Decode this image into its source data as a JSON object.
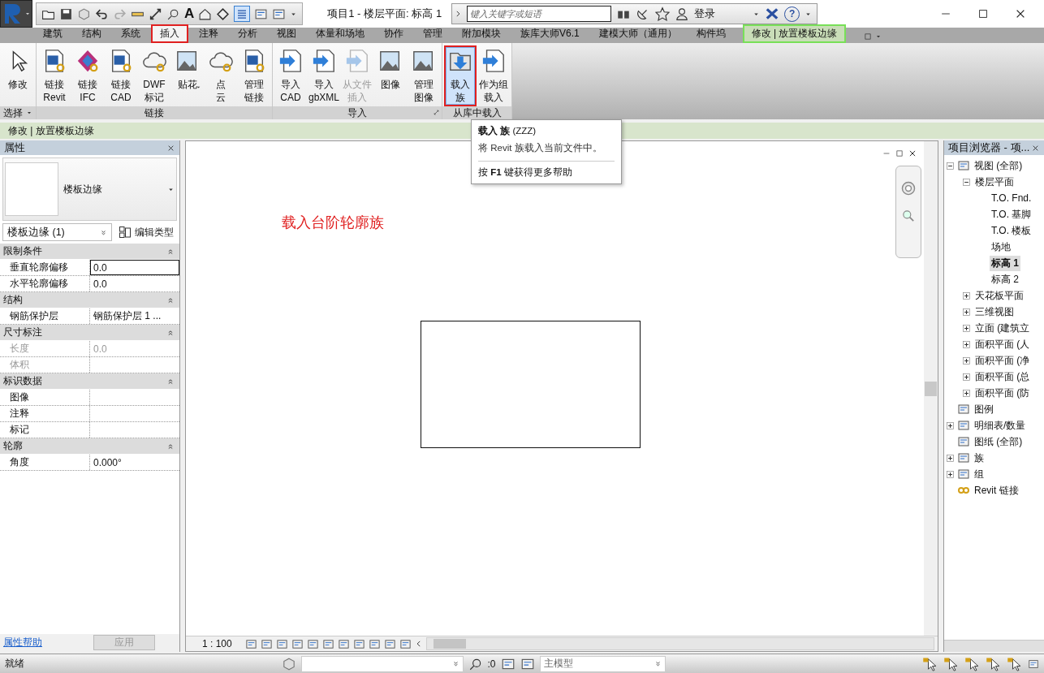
{
  "quick_access": {
    "text_tool": "A",
    "thin_lines_on": true
  },
  "title": "项目1 - 楼层平面: 标高 1",
  "search": {
    "placeholder": "键入关键字或短语"
  },
  "login": "登录",
  "help": "?",
  "tabs": [
    {
      "label": "建筑",
      "selected": false,
      "kind": "normal",
      "annotated": false
    },
    {
      "label": "结构",
      "selected": false,
      "kind": "normal",
      "annotated": false
    },
    {
      "label": "系统",
      "selected": false,
      "kind": "normal",
      "annotated": false
    },
    {
      "label": "插入",
      "selected": true,
      "kind": "normal",
      "annotated": true
    },
    {
      "label": "注释",
      "selected": false,
      "kind": "normal",
      "annotated": false
    },
    {
      "label": "分析",
      "selected": false,
      "kind": "normal",
      "annotated": false
    },
    {
      "label": "视图",
      "selected": false,
      "kind": "normal",
      "annotated": false
    },
    {
      "label": "体量和场地",
      "selected": false,
      "kind": "normal",
      "annotated": false
    },
    {
      "label": "协作",
      "selected": false,
      "kind": "normal",
      "annotated": false
    },
    {
      "label": "管理",
      "selected": false,
      "kind": "normal",
      "annotated": false
    },
    {
      "label": "附加模块",
      "selected": false,
      "kind": "normal",
      "annotated": false
    },
    {
      "label": "族库大师V6.1",
      "selected": false,
      "kind": "normal",
      "annotated": false
    },
    {
      "label": "建模大师（通用）",
      "selected": false,
      "kind": "normal",
      "annotated": false
    },
    {
      "label": "构件坞",
      "selected": false,
      "kind": "normal",
      "annotated": false
    },
    {
      "label": "修改 | 放置楼板边缘",
      "selected": false,
      "kind": "contextual",
      "annotated": false
    }
  ],
  "ribbon": {
    "panels": [
      {
        "label": "选择",
        "dropdown": true,
        "launcher": false,
        "buttons": [
          {
            "lines": [
              "修改"
            ],
            "pressed": false,
            "disabled": false,
            "dropdown": false,
            "annotated": false
          }
        ]
      },
      {
        "label": "链接",
        "dropdown": false,
        "launcher": false,
        "buttons": [
          {
            "lines": [
              "链接",
              "Revit"
            ],
            "pressed": false,
            "disabled": false,
            "dropdown": false,
            "annotated": false
          },
          {
            "lines": [
              "链接",
              "IFC"
            ],
            "pressed": false,
            "disabled": false,
            "dropdown": false,
            "annotated": false
          },
          {
            "lines": [
              "链接",
              "CAD"
            ],
            "pressed": false,
            "disabled": false,
            "dropdown": false,
            "annotated": false
          },
          {
            "lines": [
              "DWF",
              "标记"
            ],
            "pressed": false,
            "disabled": false,
            "dropdown": false,
            "annotated": false
          },
          {
            "lines": [
              "贴花"
            ],
            "pressed": false,
            "disabled": false,
            "dropdown": true,
            "annotated": false
          },
          {
            "lines": [
              "点",
              "云"
            ],
            "pressed": false,
            "disabled": false,
            "dropdown": false,
            "annotated": false
          },
          {
            "lines": [
              "管理",
              "链接"
            ],
            "pressed": false,
            "disabled": false,
            "dropdown": false,
            "annotated": false
          }
        ]
      },
      {
        "label": "导入",
        "dropdown": false,
        "launcher": true,
        "buttons": [
          {
            "lines": [
              "导入",
              "CAD"
            ],
            "pressed": false,
            "disabled": false,
            "dropdown": false,
            "annotated": false
          },
          {
            "lines": [
              "导入",
              "gbXML"
            ],
            "pressed": false,
            "disabled": false,
            "dropdown": false,
            "annotated": false
          },
          {
            "lines": [
              "从文件",
              "插入"
            ],
            "pressed": false,
            "disabled": true,
            "dropdown": true,
            "annotated": false
          },
          {
            "lines": [
              "图像"
            ],
            "pressed": false,
            "disabled": false,
            "dropdown": false,
            "annotated": false
          },
          {
            "lines": [
              "管理",
              "图像"
            ],
            "pressed": false,
            "disabled": false,
            "dropdown": false,
            "annotated": false
          }
        ]
      },
      {
        "label": "从库中载入",
        "dropdown": false,
        "launcher": false,
        "buttons": [
          {
            "lines": [
              "载入",
              "族"
            ],
            "pressed": true,
            "disabled": false,
            "dropdown": false,
            "annotated": true
          },
          {
            "lines": [
              "作为组",
              "载入"
            ],
            "pressed": false,
            "disabled": false,
            "dropdown": false,
            "annotated": false
          }
        ]
      }
    ]
  },
  "tooltip": {
    "title": "**载入 族** (ZZZ)",
    "text": "将 Revit 族载入当前文件中。",
    "help": "按 **F1** 键获得更多帮助"
  },
  "options_bar": "修改 | 放置楼板边缘",
  "properties": {
    "title": "属性",
    "type_name": "楼板边缘",
    "instance": "楼板边缘 (1)",
    "edit_type": "编辑类型",
    "groups": [
      {
        "name": "限制条件",
        "expanded": true,
        "params": [
          {
            "name": "垂直轮廓偏移",
            "value": "0.0",
            "active": true,
            "disabled": false
          },
          {
            "name": "水平轮廓偏移",
            "value": "0.0",
            "active": false,
            "disabled": false
          }
        ]
      },
      {
        "name": "结构",
        "expanded": true,
        "params": [
          {
            "name": "钢筋保护层",
            "value": "钢筋保护层 1 ...",
            "active": false,
            "disabled": false
          }
        ]
      },
      {
        "name": "尺寸标注",
        "expanded": true,
        "params": [
          {
            "name": "长度",
            "value": "0.0",
            "active": false,
            "disabled": true
          },
          {
            "name": "体积",
            "active": false,
            "disabled": true
          }
        ]
      },
      {
        "name": "标识数据",
        "expanded": true,
        "params": [
          {
            "name": "图像",
            "active": false,
            "disabled": false
          },
          {
            "name": "注释",
            "active": false,
            "disabled": false
          },
          {
            "name": "标记",
            "active": false,
            "disabled": false
          }
        ]
      },
      {
        "name": "轮廓",
        "expanded": true,
        "params": [
          {
            "name": "角度",
            "value": "0.000°",
            "active": false,
            "disabled": false
          }
        ]
      }
    ],
    "help_link": "属性帮助",
    "apply": {
      "label": "应用",
      "disabled": true
    }
  },
  "view": {
    "annotation": "载入台阶轮廓族",
    "scale": "1 : 100"
  },
  "browser": {
    "title": "项目浏览器 - 项...",
    "tree": [
      {
        "label": "视图 (全部)",
        "kind": "views",
        "expanded": true,
        "selected": false,
        "children": [
          {
            "label": "楼层平面",
            "expanded": true,
            "selected": false,
            "children": [
              {
                "label": "T.O. Fnd.",
                "selected": false
              },
              {
                "label": "T.O. 基脚",
                "selected": false
              },
              {
                "label": "T.O. 楼板",
                "selected": false
              },
              {
                "label": "场地",
                "selected": false
              },
              {
                "label": "标高 1",
                "selected": true
              },
              {
                "label": "标高 2",
                "selected": false
              }
            ]
          },
          {
            "label": "天花板平面",
            "expanded": false,
            "selected": false
          },
          {
            "label": "三维视图",
            "expanded": false,
            "selected": false
          },
          {
            "label": "立面 (建筑立",
            "expanded": false,
            "selected": false
          },
          {
            "label": "面积平面 (人",
            "expanded": false,
            "selected": false
          },
          {
            "label": "面积平面 (净",
            "expanded": false,
            "selected": false
          },
          {
            "label": "面积平面 (总",
            "expanded": false,
            "selected": false
          },
          {
            "label": "面积平面 (防",
            "expanded": false,
            "selected": false
          }
        ]
      },
      {
        "label": "图例",
        "kind": "legends",
        "selected": false
      },
      {
        "label": "明细表/数量",
        "kind": "schedules",
        "expanded": false,
        "selected": false
      },
      {
        "label": "图纸 (全部)",
        "kind": "sheets",
        "selected": false
      },
      {
        "label": "族",
        "kind": "families",
        "expanded": false,
        "selected": false
      },
      {
        "label": "组",
        "kind": "groups",
        "expanded": false,
        "selected": false
      },
      {
        "label": "Revit 链接",
        "kind": "links",
        "selected": false
      }
    ]
  },
  "status_bar": {
    "text": "就绪",
    "requests": ":0",
    "model": "主模型"
  }
}
